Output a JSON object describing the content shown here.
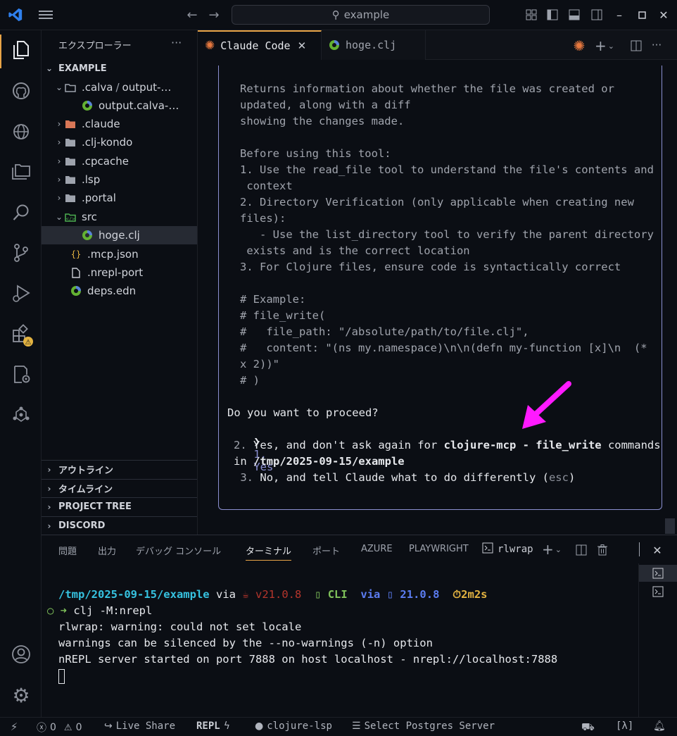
{
  "titlebar": {
    "search_text": "example",
    "colors": {
      "vscode_blue": "#2f80ed"
    }
  },
  "activity_icons": [
    "explorer-icon",
    "github-icon",
    "globe-icon",
    "folders-icon",
    "search-icon",
    "source-control-icon",
    "run-debug-icon",
    "extensions-icon",
    "test-config-icon",
    "graph-icon",
    "account-icon",
    "settings-gear-icon"
  ],
  "sidebar": {
    "title": "エクスプローラー",
    "root": "EXAMPLE",
    "items": [
      {
        "label": ".calva",
        "suffix": "output-…"
      },
      {
        "label": "output.calva-…"
      },
      {
        "label": ".claude"
      },
      {
        "label": ".clj-kondo"
      },
      {
        "label": ".cpcache"
      },
      {
        "label": ".lsp"
      },
      {
        "label": ".portal"
      },
      {
        "label": "src"
      },
      {
        "label": "hoge.clj"
      },
      {
        "label": ".mcp.json"
      },
      {
        "label": ".nrepl-port"
      },
      {
        "label": "deps.edn"
      }
    ],
    "sections": [
      "アウトライン",
      "タイムライン",
      "PROJECT TREE",
      "DISCORD"
    ]
  },
  "editor": {
    "tabs": [
      {
        "label": "Claude Code",
        "active": true
      },
      {
        "label": "hoge.clj",
        "active": false
      }
    ],
    "lines": [
      "Returns information about whether the file was created or",
      "updated, along with a diff",
      "showing the changes made.",
      "",
      "Before using this tool:",
      "1. Use the read_file tool to understand the file's contents and",
      " context",
      "2. Directory Verification (only applicable when creating new",
      "files):",
      "   - Use the list_directory tool to verify the parent directory",
      " exists and is the correct location",
      "3. For Clojure files, ensure code is syntactically correct",
      "",
      "# Example:",
      "# file_write(",
      "#   file_path: \"/absolute/path/to/file.clj\",",
      "#   content: \"(ns my.namespace)\\n\\n(defn my-function [x]\\n  (*",
      "x 2))\"",
      "# )"
    ],
    "prompt": {
      "question": "Do you want to proceed?",
      "cursor": "❯",
      "opt1_num": "1.",
      "opt1_text": "Yes",
      "opt2_num": "2.",
      "opt2_pre": "Yes, and don't ask again for ",
      "opt2_bold": "clojure-mcp - file_write",
      "opt2_post": " commands",
      "opt2_line2_pre": "in ",
      "opt2_line2_bold": "/tmp/2025-09-15/example",
      "opt3_num": "3.",
      "opt3_pre": "No, and tell Claude what to do differently (",
      "opt3_esc": "esc",
      "opt3_post": ")"
    },
    "arrow_color": "#ff1aff"
  },
  "panel": {
    "tabs": [
      "問題",
      "出力",
      "デバッグ コンソール",
      "ターミナル",
      "ポート",
      "AZURE",
      "PLAYWRIGHT"
    ],
    "active_tab": "ターミナル",
    "terminal_name": "rlwrap",
    "terminal": {
      "path": "/tmp/2025-09-15/example",
      "via1": "via",
      "java_ver": "v21.0.8",
      "cli": "CLI",
      "via2": "via",
      "ver2": "21.0.8",
      "timer": "2m2s",
      "cmd_prefix": "○ ➜",
      "cmd": "clj -M:nrepl",
      "out1": "rlwrap: warning: could not set locale",
      "out2": "warnings can be silenced by the --no-warnings (-n) option",
      "out3": "nREPL server started on port 7888 on host localhost - nrepl://localhost:7888"
    }
  },
  "statusbar": {
    "errors": "0",
    "warnings": "0",
    "live_share": "Live Share",
    "repl": "REPL",
    "lsp": "clojure-lsp",
    "postgres": "Select Postgres Server",
    "lambda": "[λ]"
  }
}
